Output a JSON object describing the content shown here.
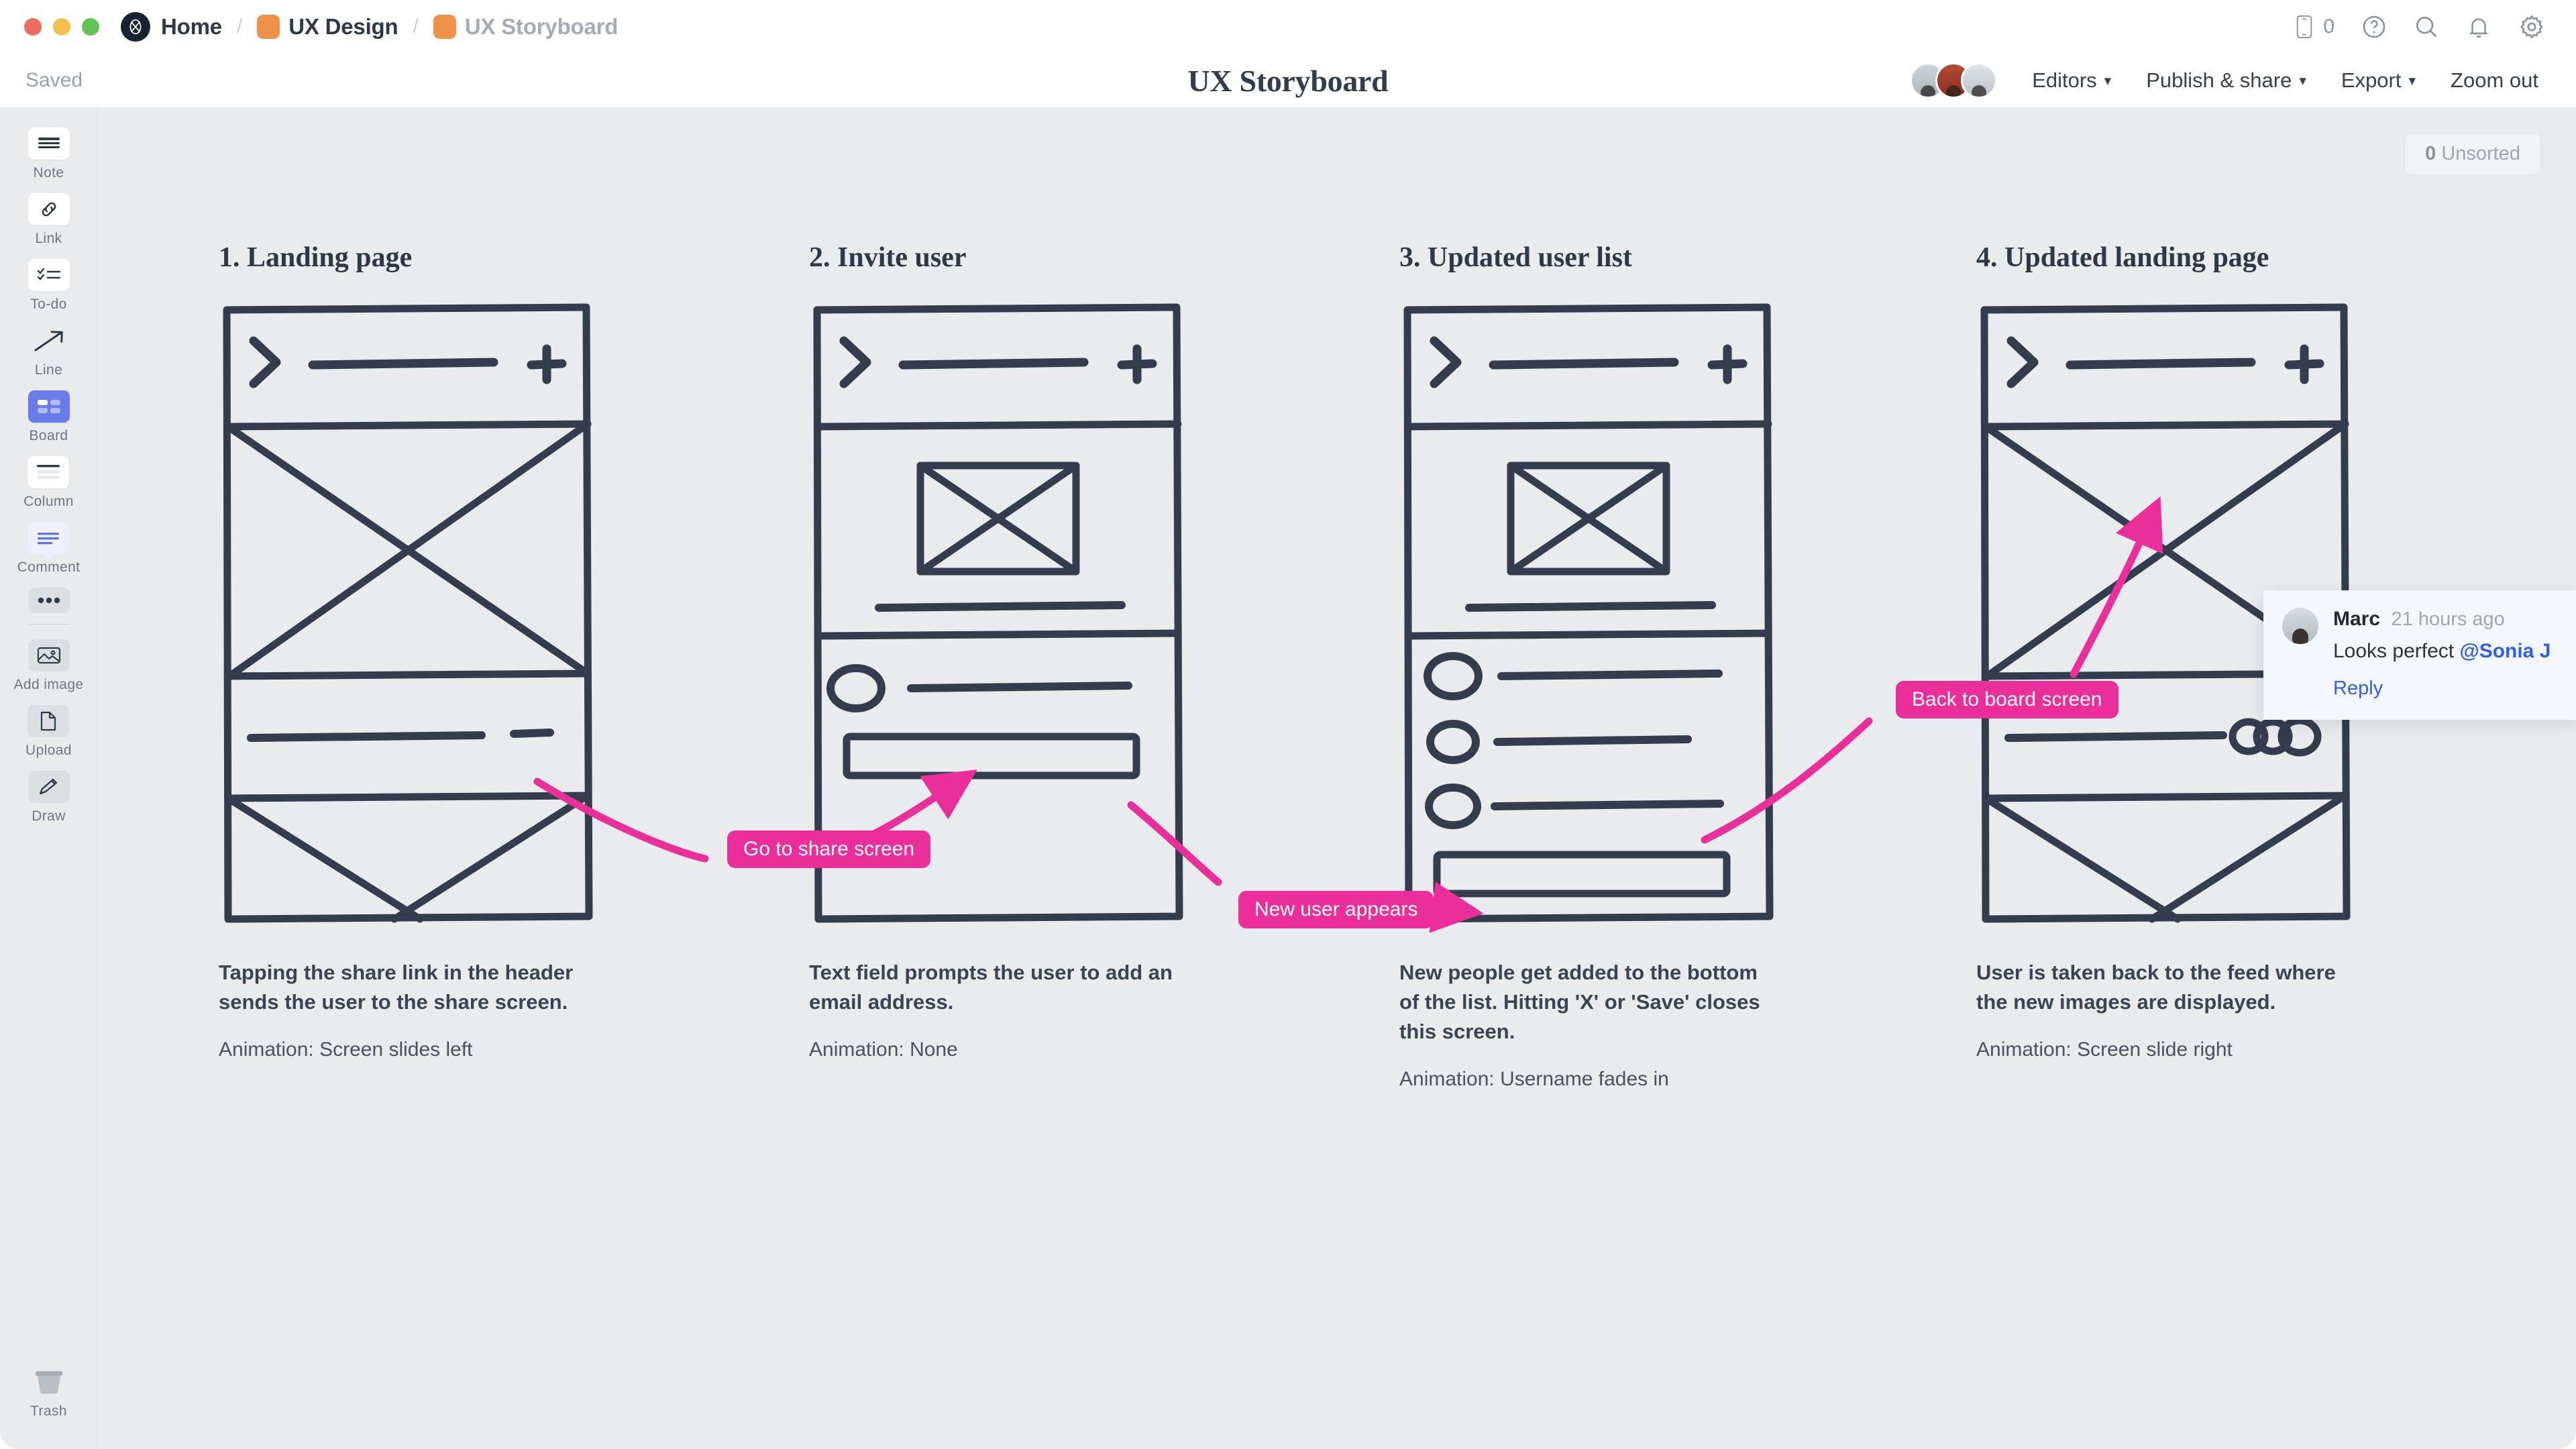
{
  "window": {
    "traffic_lights": [
      "close",
      "minimize",
      "maximize"
    ]
  },
  "breadcrumb": {
    "items": [
      {
        "label": "Home",
        "icon": "milanote-logo-icon"
      },
      {
        "label": "UX Design",
        "icon": "folder-icon"
      },
      {
        "label": "UX Storyboard",
        "icon": "folder-icon"
      }
    ],
    "separator": "/"
  },
  "titlebar_icons": {
    "phone_count": "0",
    "phone": "phone-icon",
    "help": "question-circle-icon",
    "search": "search-icon",
    "notifications": "bell-icon",
    "settings": "gear-icon"
  },
  "actionbar": {
    "save_status": "Saved",
    "document_title": "UX Storyboard",
    "menus": [
      {
        "label": "Editors",
        "has_chevron": true
      },
      {
        "label": "Publish & share",
        "has_chevron": true
      },
      {
        "label": "Export",
        "has_chevron": true
      },
      {
        "label": "Zoom out",
        "has_chevron": false
      }
    ]
  },
  "sidebar": {
    "items": [
      {
        "label": "Note",
        "icon": "note-icon",
        "active": false,
        "style": "white"
      },
      {
        "label": "Link",
        "icon": "link-icon",
        "active": false,
        "style": "white"
      },
      {
        "label": "To-do",
        "icon": "todo-icon",
        "active": false,
        "style": "white"
      },
      {
        "label": "Line",
        "icon": "line-arrow-icon",
        "active": false,
        "style": "plain"
      },
      {
        "label": "Board",
        "icon": "board-icon",
        "active": true,
        "style": "active"
      },
      {
        "label": "Column",
        "icon": "column-icon",
        "active": false,
        "style": "white"
      },
      {
        "label": "Comment",
        "icon": "comment-icon",
        "active": false,
        "style": "lilac"
      },
      {
        "label": "",
        "icon": "more-ellipsis-icon",
        "active": false,
        "style": "grey"
      }
    ],
    "items_secondary": [
      {
        "label": "Add image",
        "icon": "image-icon",
        "style": "grey"
      },
      {
        "label": "Upload",
        "icon": "file-icon",
        "style": "grey"
      },
      {
        "label": "Draw",
        "icon": "pencil-icon",
        "style": "grey"
      }
    ],
    "trash": {
      "label": "Trash",
      "icon": "trash-icon"
    }
  },
  "canvas": {
    "unsorted_badge": {
      "count": "0",
      "label": "Unsorted"
    }
  },
  "frames": [
    {
      "title": "1. Landing page",
      "caption_main": "Tapping the share link in the header sends the user to the share screen.",
      "caption_animation": "Animation: Screen slides left"
    },
    {
      "title": "2. Invite user",
      "caption_main": "Text field prompts the user to add an email address.",
      "caption_animation": "Animation: None"
    },
    {
      "title": "3. Updated user list",
      "caption_main": "New people get added to the bottom of the list. Hitting 'X' or 'Save' closes this screen.",
      "caption_animation": "Animation: Username fades in"
    },
    {
      "title": "4. Updated landing page",
      "caption_main": "User is taken back to the feed where the new images are displayed.",
      "caption_animation": "Animation: Screen slide right"
    }
  ],
  "connector_labels": [
    {
      "text": "Go to share screen"
    },
    {
      "text": "New user appears"
    },
    {
      "text": "Back to board screen"
    }
  ],
  "comment": {
    "author": "Marc",
    "timestamp": "21 hours ago",
    "body_prefix": "Looks perfect ",
    "mention": "@Sonia J",
    "reply_label": "Reply"
  },
  "colors": {
    "accent_pink": "#eb2f9a",
    "ink": "#2d3a4b",
    "canvas_bg": "#e9ebed",
    "link_blue": "#2f5fe8",
    "board_active": "#6b7bec",
    "folder_orange": "#f0934a"
  }
}
